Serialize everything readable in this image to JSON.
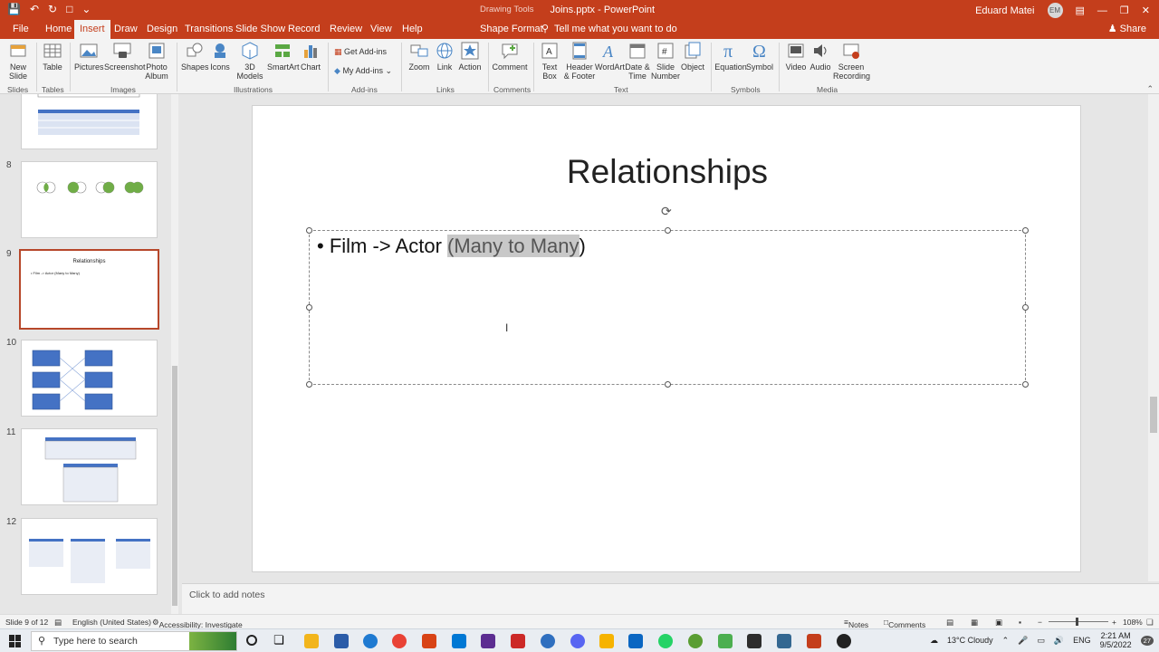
{
  "titlebar": {
    "context": "Drawing Tools",
    "file": "Joins.pptx",
    "app": "PowerPoint",
    "user": "Eduard Matei",
    "initials": "EM"
  },
  "tabs": [
    "File",
    "Home",
    "Insert",
    "Draw",
    "Design",
    "Transitions",
    "Slide Show",
    "Record",
    "Review",
    "View",
    "Help",
    "Shape Format"
  ],
  "tellme": "Tell me what you want to do",
  "share": "Share",
  "ribbon": {
    "slides": {
      "new_slide": "New Slide",
      "group": "Slides"
    },
    "tables": {
      "table": "Table",
      "group": "Tables"
    },
    "images": {
      "pictures": "Pictures",
      "screenshot": "Screenshot",
      "photo_album": "Photo Album",
      "group": "Images"
    },
    "illustrations": {
      "shapes": "Shapes",
      "icons": "Icons",
      "models": "3D Models",
      "smartart": "SmartArt",
      "chart": "Chart",
      "group": "Illustrations"
    },
    "addins": {
      "get": "Get Add-ins",
      "my": "My Add-ins",
      "group": "Add-ins"
    },
    "links": {
      "zoom": "Zoom",
      "link": "Link",
      "action": "Action",
      "group": "Links"
    },
    "comments": {
      "comment": "Comment",
      "group": "Comments"
    },
    "text": {
      "textbox": "Text Box",
      "header": "Header & Footer",
      "wordart": "WordArt",
      "datetime": "Date & Time",
      "slidenum": "Slide Number",
      "object": "Object",
      "group": "Text"
    },
    "symbols": {
      "equation": "Equation",
      "symbol": "Symbol",
      "group": "Symbols"
    },
    "media": {
      "video": "Video",
      "audio": "Audio",
      "screenrec": "Screen Recording",
      "group": "Media"
    }
  },
  "thumbnails": [
    {
      "num": "8"
    },
    {
      "num": "9",
      "title": "Relationships",
      "line": "• Film -> Actor (Many to Many)"
    },
    {
      "num": "10"
    },
    {
      "num": "11"
    },
    {
      "num": "12"
    }
  ],
  "slide": {
    "title": "Relationships",
    "bullet_prefix": "Film -> Actor ",
    "bullet_highlight": "(Many to Many",
    "bullet_suffix": ")"
  },
  "notes_placeholder": "Click to add notes",
  "status": {
    "slide": "Slide 9 of 12",
    "language": "English (United States)",
    "accessibility": "Accessibility: Investigate",
    "notes": "Notes",
    "comments": "Comments",
    "zoom": "108%"
  },
  "taskbar": {
    "search": "Type here to search",
    "weather": "13°C  Cloudy",
    "lang": "ENG",
    "time": "2:21 AM",
    "date": "9/5/2022",
    "badge": "27"
  },
  "colors": {
    "brand": "#c43e1c",
    "selected_border": "#b7472a"
  }
}
